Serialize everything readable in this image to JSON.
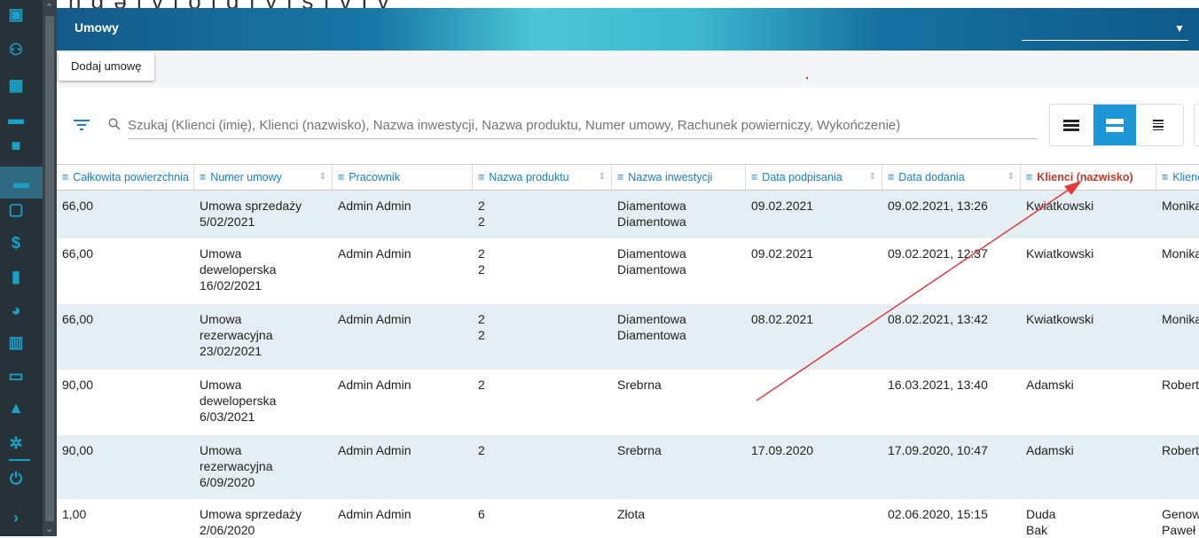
{
  "page_heading": "j n g ə l v l o i d ı y l s ı v ı v",
  "header": {
    "title": "Umowy",
    "select_value": ""
  },
  "toolbar": {
    "add_label": "Dodaj umowę"
  },
  "search": {
    "placeholder": "Szukaj (Klienci (imię), Klienci (nazwisko), Nazwa inwestycji, Nazwa produktu, Numer umowy, Rachunek powierniczy, Wykończenie)"
  },
  "rail_icons": [
    "calendar-icon",
    "people-icon",
    "building-icon",
    "store-icon",
    "briefcase-icon",
    "folder-icon",
    "inbox-icon",
    "dollar-icon",
    "document-icon",
    "pie-chart-icon",
    "bar-chart-icon",
    "card-icon",
    "warning-icon",
    "gear-icon",
    "power-icon",
    "chevron-right-icon"
  ],
  "columns": [
    {
      "key": "area",
      "label": "Całkowita powierzchnia"
    },
    {
      "key": "number",
      "label": "Numer umowy"
    },
    {
      "key": "employee",
      "label": "Pracownik"
    },
    {
      "key": "product",
      "label": "Nazwa produktu"
    },
    {
      "key": "investment",
      "label": "Nazwa inwestycji"
    },
    {
      "key": "signed",
      "label": "Data podpisania"
    },
    {
      "key": "added",
      "label": "Data dodania"
    },
    {
      "key": "surname",
      "label": "Klienci (nazwisko)"
    },
    {
      "key": "firstname",
      "label": "Klienci (imię)"
    }
  ],
  "rows": [
    {
      "area": "66,00",
      "number": "Umowa sprzedaży\n5/02/2021",
      "employee": "Admin Admin",
      "product": "2\n2",
      "investment": "Diamentowa\nDiamentowa",
      "signed": "09.02.2021",
      "added": "09.02.2021, 13:26",
      "surname": "Kwiatkowski",
      "firstname": "Monika"
    },
    {
      "area": "66,00",
      "number": "Umowa\ndeweloperska\n16/02/2021",
      "employee": "Admin Admin",
      "product": "2\n2",
      "investment": "Diamentowa\nDiamentowa",
      "signed": "09.02.2021",
      "added": "09.02.2021, 12:37",
      "surname": "Kwiatkowski",
      "firstname": "Monika"
    },
    {
      "area": "66,00",
      "number": "Umowa\nrezerwacyjna\n23/02/2021",
      "employee": "Admin Admin",
      "product": "2\n2",
      "investment": "Diamentowa\nDiamentowa",
      "signed": "08.02.2021",
      "added": "08.02.2021, 13:42",
      "surname": "Kwiatkowski",
      "firstname": "Monika"
    },
    {
      "area": "90,00",
      "number": "Umowa\ndeweloperska\n6/03/2021",
      "employee": "Admin Admin",
      "product": "2",
      "investment": "Srebrna",
      "signed": "",
      "added": "16.03.2021, 13:40",
      "surname": "Adamski",
      "firstname": "Robert"
    },
    {
      "area": "90,00",
      "number": "Umowa\nrezerwacyjna\n6/09/2020",
      "employee": "Admin Admin",
      "product": "2",
      "investment": "Srebrna",
      "signed": "17.09.2020",
      "added": "17.09.2020, 10:47",
      "surname": "Adamski",
      "firstname": "Robert"
    },
    {
      "area": "1,00",
      "number": "Umowa sprzedaży\n2/06/2020",
      "employee": "Admin Admin",
      "product": "6",
      "investment": "Złota",
      "signed": "",
      "added": "02.06.2020, 15:15",
      "surname": "Duda\nBak",
      "firstname": "Genowefa\nPaweł"
    }
  ],
  "colors": {
    "accent": "#1a7fc0",
    "sorted_header": "#c0392b",
    "annotation_arrow": "#e33b3b",
    "row_alt": "#e5eef3"
  }
}
